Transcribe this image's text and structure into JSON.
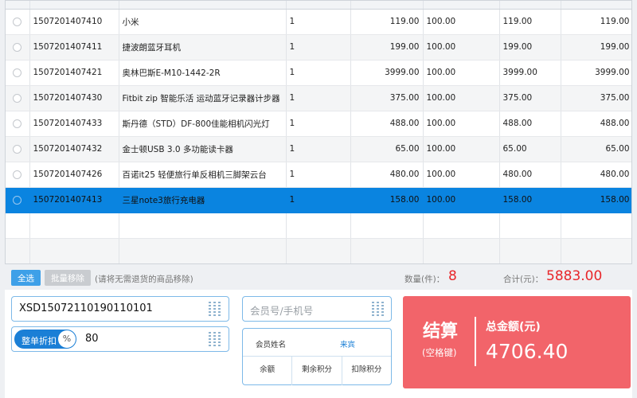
{
  "table": {
    "rows": [
      {
        "code": "1507201407410",
        "name": "小米",
        "qty": "1",
        "price": "119.00",
        "discount": "100.00",
        "discount_price": "119.00",
        "subtotal": "119.00",
        "selected": false
      },
      {
        "code": "1507201407411",
        "name": "捷波朗蓝牙耳机",
        "qty": "1",
        "price": "199.00",
        "discount": "100.00",
        "discount_price": "199.00",
        "subtotal": "199.00",
        "selected": false
      },
      {
        "code": "1507201407421",
        "name": "奥林巴斯E-M10-1442-2R",
        "qty": "1",
        "price": "3999.00",
        "discount": "100.00",
        "discount_price": "3999.00",
        "subtotal": "3999.00",
        "selected": false
      },
      {
        "code": "1507201407430",
        "name": "Fitbit zip 智能乐活 运动蓝牙记录器计步器",
        "qty": "1",
        "price": "375.00",
        "discount": "100.00",
        "discount_price": "375.00",
        "subtotal": "375.00",
        "selected": false
      },
      {
        "code": "1507201407433",
        "name": "斯丹德（STD）DF-800佳能相机闪光灯",
        "qty": "1",
        "price": "488.00",
        "discount": "100.00",
        "discount_price": "488.00",
        "subtotal": "488.00",
        "selected": false
      },
      {
        "code": "1507201407432",
        "name": "金士顿USB 3.0 多功能读卡器",
        "qty": "1",
        "price": "65.00",
        "discount": "100.00",
        "discount_price": "65.00",
        "subtotal": "65.00",
        "selected": false
      },
      {
        "code": "1507201407426",
        "name": "百诺it25 轻便旅行单反相机三脚架云台",
        "qty": "1",
        "price": "480.00",
        "discount": "100.00",
        "discount_price": "480.00",
        "subtotal": "480.00",
        "selected": false
      },
      {
        "code": "1507201407413",
        "name": "三星note3旅行充电器",
        "qty": "1",
        "price": "158.00",
        "discount": "100.00",
        "discount_price": "158.00",
        "subtotal": "158.00",
        "selected": true
      }
    ],
    "empty_rows": 2
  },
  "toolbar": {
    "select_all_label": "全选",
    "batch_remove_label": "批量移除",
    "hint": "(请将无需退货的商品移除)"
  },
  "summary": {
    "qty_label": "数量(件)：",
    "qty_value": "8",
    "total_label": "合计(元)：",
    "total_value": "5883.00"
  },
  "order": {
    "order_no": "XSD15072110190110101"
  },
  "discount": {
    "toggle_label": "整单折扣",
    "toggle_symbol": "%",
    "value": "80"
  },
  "member": {
    "placeholder": "会员号/手机号",
    "name_label": "会员姓名",
    "name_value": "来宾",
    "balance_label": "余额",
    "points_label": "剩余积分",
    "deduct_label": "扣除积分"
  },
  "checkout": {
    "button_label": "结算",
    "shortcut": "(空格键)",
    "amount_label": "总金额(元)",
    "amount_value": "4706.40"
  },
  "colors": {
    "accent": "#0a84e0",
    "checkout_bg": "#f2646a",
    "total_red": "#e8262a"
  }
}
